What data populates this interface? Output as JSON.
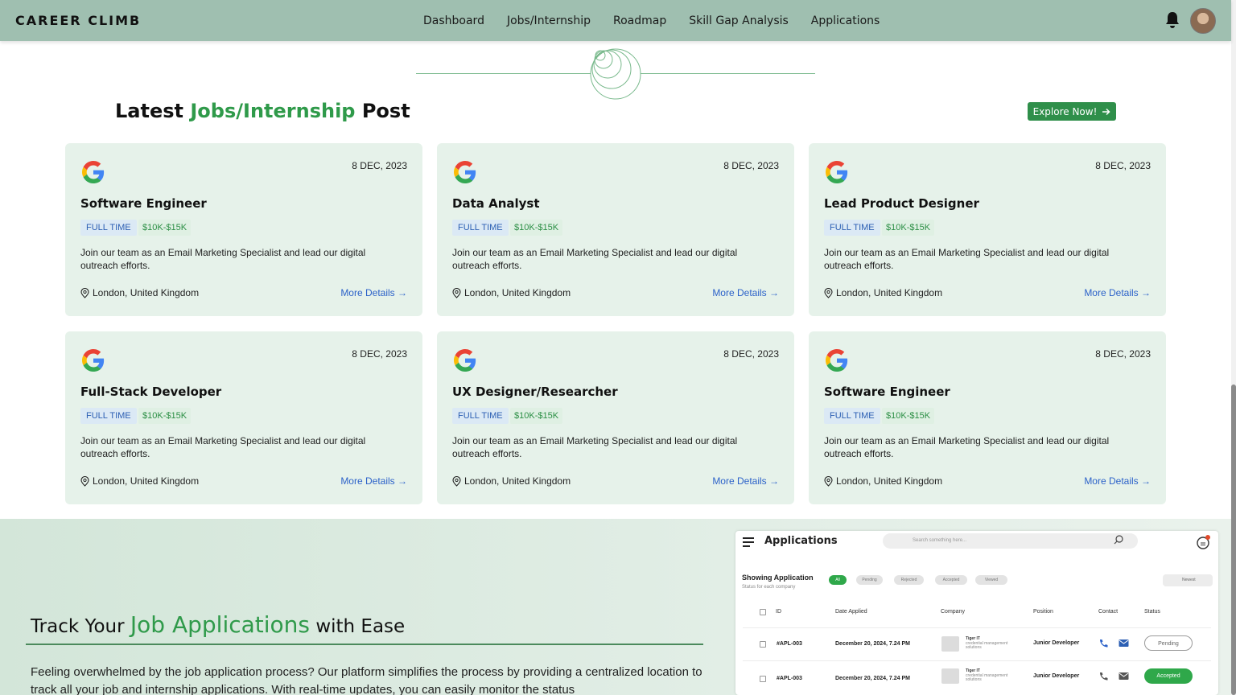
{
  "nav": {
    "brand": "CAREER CLIMB",
    "links": [
      "Dashboard",
      "Jobs/Internship",
      "Roadmap",
      "Skill Gap Analysis",
      "Applications"
    ],
    "icons": [
      "bell-icon",
      "avatar"
    ]
  },
  "jobs_section": {
    "title_pre": "Latest ",
    "title_accent": "Jobs/Internship",
    "title_post": " Post",
    "explore_label": "Explore Now!",
    "accent_color": "#2f9a4a"
  },
  "cards": [
    {
      "date": "8 DEC, 2023",
      "title": "Software Engineer",
      "type": "FULL TIME",
      "salary": "$10K-$15K",
      "desc": "Join our team as an Email Marketing Specialist and lead our digital outreach efforts.",
      "location": "London, United Kingdom",
      "more": "More Details →"
    },
    {
      "date": "8 DEC, 2023",
      "title": "Data Analyst",
      "type": "FULL TIME",
      "salary": "$10K-$15K",
      "desc": "Join our team as an Email Marketing Specialist and lead our digital outreach efforts.",
      "location": "London, United Kingdom",
      "more": "More Details →"
    },
    {
      "date": "8 DEC, 2023",
      "title": "Lead Product Designer",
      "type": "FULL TIME",
      "salary": "$10K-$15K",
      "desc": "Join our team as an Email Marketing Specialist and lead our digital outreach efforts.",
      "location": "London, United Kingdom",
      "more": "More Details →"
    },
    {
      "date": "8 DEC, 2023",
      "title": "Full-Stack Developer",
      "type": "FULL TIME",
      "salary": "$10K-$15K",
      "desc": "Join our team as an Email Marketing Specialist and lead our digital outreach efforts.",
      "location": "London, United Kingdom",
      "more": "More Details →"
    },
    {
      "date": "8 DEC, 2023",
      "title": "UX Designer/Researcher",
      "type": "FULL TIME",
      "salary": "$10K-$15K",
      "desc": "Join our team as an Email Marketing Specialist and lead our digital outreach efforts.",
      "location": "London, United Kingdom",
      "more": "More Details →"
    },
    {
      "date": "8 DEC, 2023",
      "title": "Software Engineer",
      "type": "FULL TIME",
      "salary": "$10K-$15K",
      "desc": "Join our team as an Email Marketing Specialist and lead our digital outreach efforts.",
      "location": "London, United Kingdom",
      "more": "More Details →"
    }
  ],
  "track": {
    "title_pre": "Track Your ",
    "title_accent": "Job Applications",
    "title_post": " with Ease",
    "text": "Feeling overwhelmed by the job application process? Our platform simplifies the process by providing a centralized location to track all your job and internship applications. With real-time updates, you can easily monitor the status"
  },
  "mock": {
    "title": "Applications",
    "search_placeholder": "Search something here...",
    "showing": "Showing Application",
    "sub": "Status for each company",
    "chips": [
      "All",
      "Pending",
      "Rejected",
      "Accepted",
      "Viewed"
    ],
    "sort": "Newest",
    "headers": [
      "ID",
      "Date Applied",
      "Company",
      "Position",
      "Contact",
      "Status"
    ],
    "rows": [
      {
        "id": "#APL-003",
        "date": "December 20, 2024, 7.24 PM",
        "company": "Tiger IT",
        "company_sub": "credential management solutions",
        "position": "Junior Developer",
        "status": "Pending"
      },
      {
        "id": "#APL-003",
        "date": "December 20, 2024, 7.24 PM",
        "company": "Tiger IT",
        "company_sub": "credential management solutions",
        "position": "Junior Developer",
        "status": "Accepted"
      }
    ]
  },
  "colors": {
    "nav_bg": "#9fbfb0",
    "card_bg": "#e6f2ea",
    "accent": "#2f9a4a",
    "link": "#2c62c9"
  }
}
